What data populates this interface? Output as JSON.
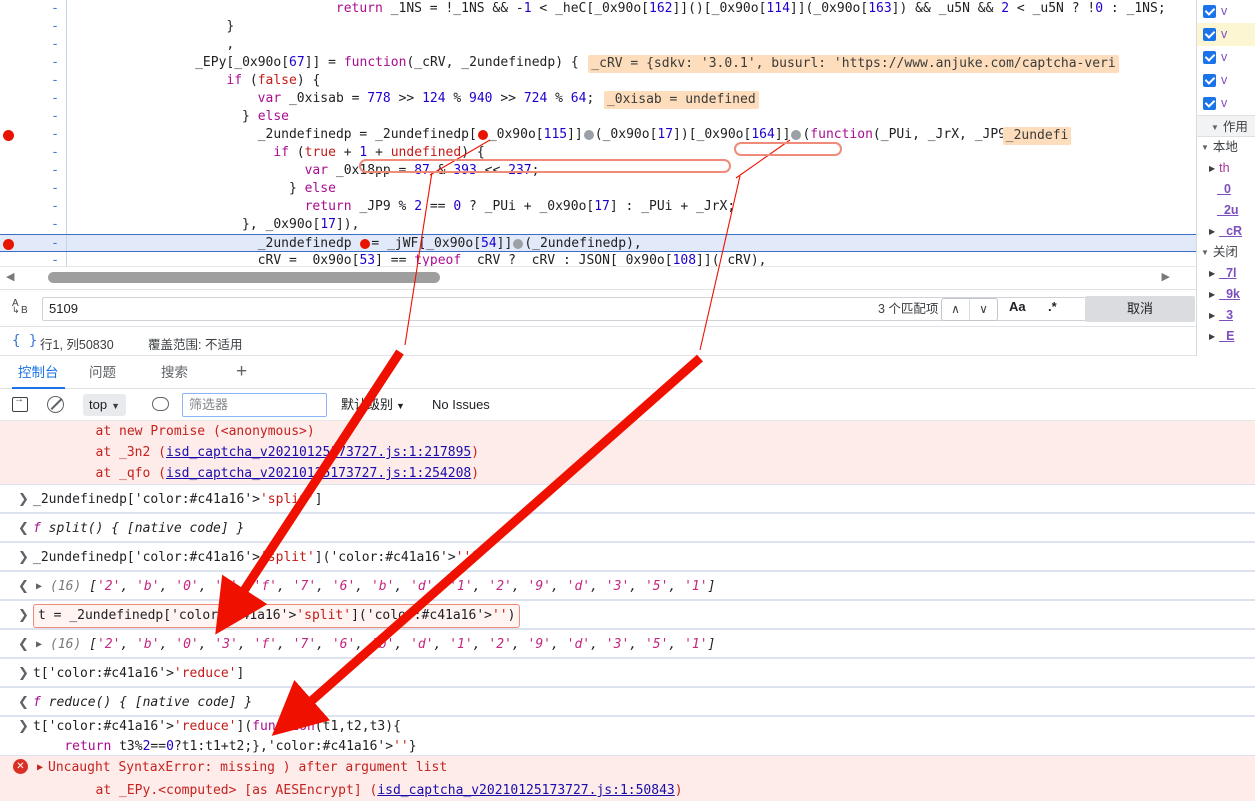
{
  "editor": {
    "lines": [
      {
        "gutter": "-",
        "breakpoint": false,
        "executing": false,
        "indent": 34,
        "html": "return _1NS = !_1NS && -1 < _heC[_0x90o[162]]()[_0x90o[114]](_0x90o[163]) && _u5N && 2 < _u5N ? !0 : _1NS;"
      },
      {
        "gutter": "-",
        "breakpoint": false,
        "executing": false,
        "indent": 20,
        "html": "}"
      },
      {
        "gutter": "-",
        "breakpoint": false,
        "executing": false,
        "indent": 20,
        "html": ","
      },
      {
        "gutter": "-",
        "breakpoint": false,
        "executing": false,
        "indent": 16,
        "html": "_EPy[_0x90o[67]] = function(_cRV, _2undefinedp) {",
        "badge": "_cRV = {sdkv: '3.0.1', busurl: 'https://www.anjuke.com/captcha-veri"
      },
      {
        "gutter": "-",
        "breakpoint": false,
        "executing": false,
        "indent": 20,
        "html": "if (false) {"
      },
      {
        "gutter": "-",
        "breakpoint": false,
        "executing": false,
        "indent": 24,
        "html": "var _0xisab = 778 >> 124 % 940 >> 724 % 64;",
        "badge": "_0xisab = undefined"
      },
      {
        "gutter": "-",
        "breakpoint": false,
        "executing": false,
        "indent": 22,
        "html": "} else"
      },
      {
        "gutter": "-",
        "breakpoint": true,
        "executing": false,
        "indent": 24,
        "html": "_2undefinedp = _2undefinedp[●_0x90o[115]]●(_0x90o[17])[_0x90o[164]]●(function(_PUi, _JrX, _JP9) {",
        "badge": "_2undefi"
      },
      {
        "gutter": "-",
        "breakpoint": false,
        "executing": false,
        "indent": 26,
        "html": "if (true + 1 + undefined) {"
      },
      {
        "gutter": "-",
        "breakpoint": false,
        "executing": false,
        "indent": 30,
        "html": "var _0x18pp = 87 & 393 << 237;"
      },
      {
        "gutter": "-",
        "breakpoint": false,
        "executing": false,
        "indent": 28,
        "html": "} else"
      },
      {
        "gutter": "-",
        "breakpoint": false,
        "executing": false,
        "indent": 30,
        "html": "return _JP9 % 2 == 0 ? _PUi + _0x90o[17] : _PUi + _JrX;"
      },
      {
        "gutter": "-",
        "breakpoint": false,
        "executing": false,
        "indent": 22,
        "html": "}, _0x90o[17]),"
      },
      {
        "gutter": "-",
        "breakpoint": true,
        "executing": true,
        "indent": 24,
        "html": "_2undefinedp ●= _jWF[_0x90o[54]]●(_2undefinedp),"
      },
      {
        "gutter": "-",
        "breakpoint": false,
        "executing": false,
        "indent": 24,
        "html": "cRV = _0x90o[53] == typeof _cRV ? _cRV : JSON[_0x90o[108]](_cRV),"
      }
    ]
  },
  "find": {
    "icon_name": "find-replace-icon",
    "icon_a": "A",
    "icon_b": "B",
    "value": "5109",
    "placeholder": "",
    "matches_label": "3 个匹配项",
    "prev_label": "∧",
    "next_label": "∨",
    "match_case_label": "Aa",
    "regex_label": ".*",
    "cancel_label": "取消"
  },
  "status": {
    "format_icon": "{ }",
    "position": "行1, 列50830",
    "coverage": "覆盖范围: 不适用"
  },
  "drawer": {
    "tabs": [
      {
        "label": "控制台",
        "active": true
      },
      {
        "label": "问题",
        "active": false
      },
      {
        "label": "搜索",
        "active": false
      }
    ],
    "add_label": "+"
  },
  "console_toolbar": {
    "drawer_icon": "drawer-toggle-icon",
    "clear_icon": "clear-console-icon",
    "context": "top",
    "context_caret": "▼",
    "eye_icon": "live-expression-icon",
    "filter_placeholder": "筛选器",
    "level": "默认级别",
    "level_caret": "▼",
    "issues": "No Issues"
  },
  "console": {
    "rows": [
      {
        "kind": "error-trace",
        "glyph": "",
        "text": "at new Promise (<anonymous>)",
        "indent": 8
      },
      {
        "kind": "error-trace",
        "glyph": "",
        "text": "at _3n2 (",
        "link": "isd_captcha_v20210125173727.js:1:217895",
        "tail": ")",
        "indent": 8
      },
      {
        "kind": "error-trace",
        "glyph": "",
        "text": "at _qfo (",
        "link": "isd_captcha_v20210125173727.js:1:254208",
        "tail": ")",
        "indent": 8
      },
      {
        "kind": "input",
        "glyph": "❯",
        "text": "_2undefinedp['split']"
      },
      {
        "kind": "output",
        "glyph": "❮",
        "text": "f split() { [native code] }"
      },
      {
        "kind": "input",
        "glyph": "❯",
        "text": "_2undefinedp['split']('')"
      },
      {
        "kind": "output-array",
        "glyph": "❮",
        "count": "(16)",
        "items": [
          "'2'",
          "'b'",
          "'0'",
          "'3'",
          "'f'",
          "'7'",
          "'6'",
          "'b'",
          "'d'",
          "'1'",
          "'2'",
          "'9'",
          "'d'",
          "'3'",
          "'5'",
          "'1'"
        ]
      },
      {
        "kind": "input-highlight",
        "glyph": "❯",
        "text": "t = _2undefinedp['split']('')"
      },
      {
        "kind": "output-array",
        "glyph": "❮",
        "count": "(16)",
        "items": [
          "'2'",
          "'b'",
          "'0'",
          "'3'",
          "'f'",
          "'7'",
          "'6'",
          "'b'",
          "'d'",
          "'1'",
          "'2'",
          "'9'",
          "'d'",
          "'3'",
          "'5'",
          "'1'"
        ]
      },
      {
        "kind": "input",
        "glyph": "❯",
        "text": "t['reduce']"
      },
      {
        "kind": "output",
        "glyph": "❮",
        "text": "f reduce() { [native code] }"
      },
      {
        "kind": "input-multiline",
        "glyph": "❯",
        "line1": "t['reduce'](function(t1,t2,t3){",
        "line2": "return t3%2==0?t1:t1+t2;},''}"
      },
      {
        "kind": "error",
        "glyph": "✕",
        "text": "Uncaught SyntaxError: missing ) after argument list"
      },
      {
        "kind": "error-trace",
        "glyph": "",
        "text": "at _EPy.<computed> [as AESEncrypt] (",
        "link": "isd_captcha_v20210125173727.js:1:50843",
        "tail": ")",
        "indent": 8
      }
    ]
  },
  "right_panel": {
    "breakpoints": [
      {
        "label": "v",
        "checked": true,
        "highlight": false
      },
      {
        "label": "v",
        "checked": true,
        "highlight": true
      },
      {
        "label": "v",
        "checked": true,
        "highlight": false
      },
      {
        "label": "v",
        "checked": true,
        "highlight": false
      },
      {
        "label": "v",
        "checked": true,
        "highlight": false
      }
    ],
    "scope_header": "作用",
    "scope_groups": [
      {
        "label": "本地",
        "triangle": "▼",
        "indent": 4,
        "type": "group"
      },
      {
        "label": "th",
        "triangle": "▶",
        "indent": 12,
        "type": "prop-muted"
      },
      {
        "label": "_0",
        "triangle": "",
        "indent": 20,
        "type": "prop"
      },
      {
        "label": "_2u",
        "triangle": "",
        "indent": 20,
        "type": "prop"
      },
      {
        "label": "_cR",
        "triangle": "▶",
        "indent": 12,
        "type": "prop"
      },
      {
        "label": "关闭",
        "triangle": "▼",
        "indent": 4,
        "type": "group"
      },
      {
        "label": "_7l",
        "triangle": "▶",
        "indent": 12,
        "type": "prop"
      },
      {
        "label": "_9k",
        "triangle": "▶",
        "indent": 12,
        "type": "prop"
      },
      {
        "label": "_3",
        "triangle": "▶",
        "indent": 12,
        "type": "prop"
      },
      {
        "label": "_E",
        "triangle": "▶",
        "indent": 12,
        "type": "prop"
      }
    ]
  },
  "annotations": {
    "arrow_color": "#f01000",
    "box_color": "#f08b7a"
  },
  "colors": {
    "accent": "#1a73e8",
    "breakpoint": "#e81400",
    "error_bg": "#fdecea",
    "error_text": "#c5221f",
    "inline_value_bg": "#fdddbb",
    "exec_line_bg": "#e2e9f8"
  }
}
